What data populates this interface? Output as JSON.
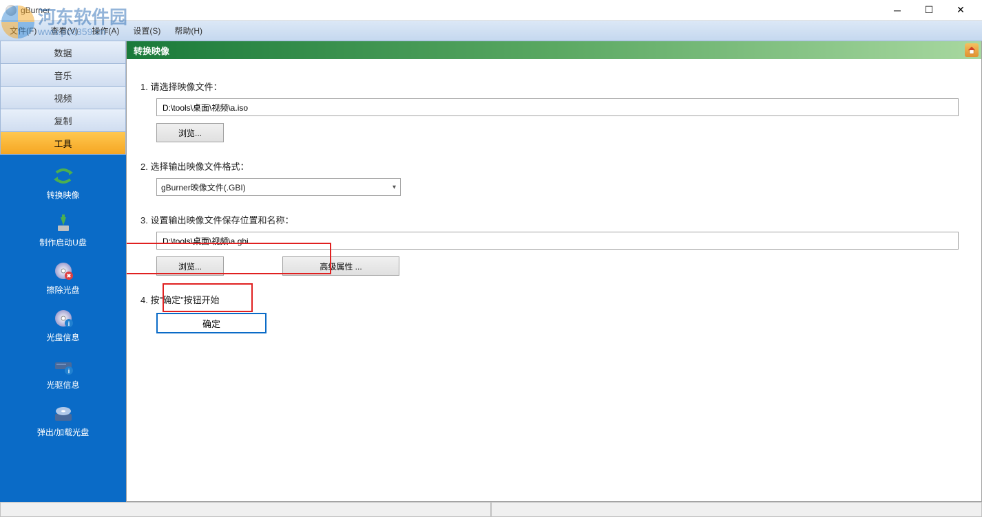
{
  "window": {
    "title": "gBurner"
  },
  "watermark": {
    "text": "河东软件园",
    "url": "www.pc0359.cn"
  },
  "menu": {
    "file": "文件(F)",
    "view": "查看(V)",
    "action": "操作(A)",
    "settings": "设置(S)",
    "help": "帮助(H)"
  },
  "sidebar": {
    "tabs": {
      "data": "数据",
      "music": "音乐",
      "video": "视频",
      "copy": "复制",
      "tools": "工具"
    },
    "tools": {
      "convert": "转换映像",
      "bootusb": "制作启动U盘",
      "erase": "擦除光盘",
      "discinfo": "光盘信息",
      "driveinfo": "光驱信息",
      "eject": "弹出/加载光盘"
    }
  },
  "content": {
    "header": "转换映像",
    "step1_label": "1. 请选择映像文件：",
    "step1_path": "D:\\tools\\桌面\\视频\\a.iso",
    "browse1": "浏览...",
    "step2_label": "2. 选择输出映像文件格式：",
    "format_selected": "gBurner映像文件(.GBI)",
    "step3_label": "3. 设置输出映像文件保存位置和名称：",
    "step3_path": "D:\\tools\\桌面\\视频\\a.gbi",
    "browse2": "浏览...",
    "advanced": "高级属性 ...",
    "step4_label": "4. 按\"确定\"按钮开始",
    "confirm": "确定"
  }
}
